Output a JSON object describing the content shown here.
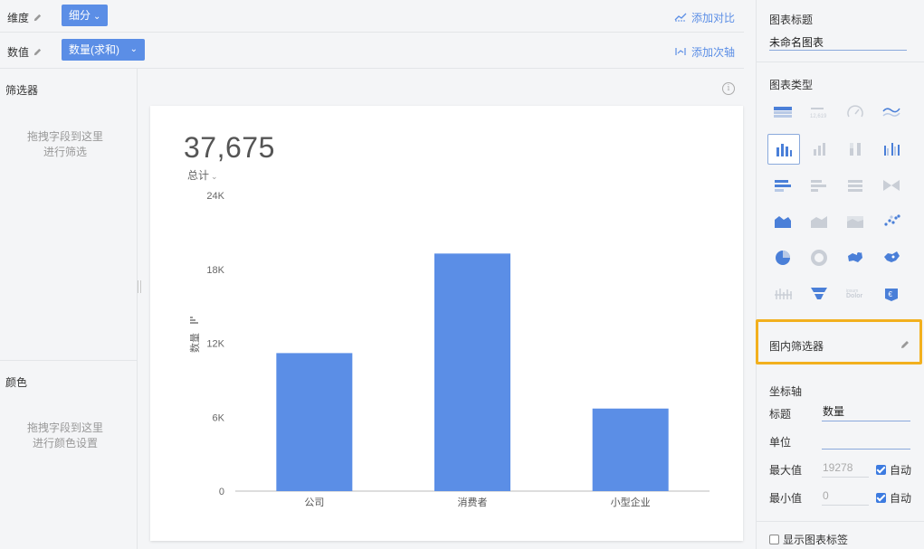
{
  "shelves": {
    "dimension": {
      "label": "维度",
      "pill": "细分",
      "action": "添加对比"
    },
    "value": {
      "label": "数值",
      "pill": "数量(求和)",
      "action": "添加次轴"
    }
  },
  "left_panel": {
    "filter_title": "筛选器",
    "filter_hint_1": "拖拽字段到这里",
    "filter_hint_2": "进行筛选",
    "color_title": "颜色",
    "color_hint_1": "拖拽字段到这里",
    "color_hint_2": "进行颜色设置"
  },
  "kpi": {
    "value": "37,675",
    "label": "总计"
  },
  "chart_data": {
    "type": "bar",
    "categories": [
      "公司",
      "消费者",
      "小型企业"
    ],
    "values": [
      11200,
      19278,
      6700
    ],
    "xlabel": "",
    "ylabel": "数量",
    "ylim": [
      0,
      24000
    ],
    "yticks": [
      0,
      6000,
      12000,
      18000,
      24000
    ],
    "ytick_labels": [
      "0",
      "6K",
      "12K",
      "18K",
      "24K"
    ],
    "bar_color": "#5b8ee6",
    "grid": false
  },
  "right_panel": {
    "chart_title_label": "图表标题",
    "chart_title_value": "未命名图表",
    "chart_type_label": "图表类型",
    "chart_types": [
      "table-icon",
      "kpi-number-icon",
      "gauge-icon",
      "line-wave-icon",
      "bar-chart-icon",
      "stacked-bar-icon",
      "percent-bar-icon",
      "grouped-bar-icon",
      "horizontal-bar-icon",
      "stacked-horizontal-bar-icon",
      "percent-horizontal-bar-icon",
      "bowtie-icon",
      "area-chart-icon",
      "stacked-area-icon",
      "percent-area-icon",
      "scatter-icon",
      "pie-chart-icon",
      "donut-chart-icon",
      "map-icon",
      "china-map-icon",
      "comb-icon",
      "funnel-icon",
      "word-cloud-icon",
      "map-pin-icon"
    ],
    "word_cloud_text": "Dolor",
    "kpi_type_text": "12,619",
    "in_chart_filter": "图内筛选器",
    "axis_section": "坐标轴",
    "axis_title_label": "标题",
    "axis_title_value": "数量",
    "axis_unit_label": "单位",
    "axis_unit_value": "",
    "axis_max_label": "最大值",
    "axis_max_value": "19278",
    "axis_min_label": "最小值",
    "axis_min_value": "0",
    "auto_label": "自动",
    "show_label": "显示图表标签"
  },
  "colors": {
    "accent": "#5b8ee6",
    "highlight": "#f2b01e"
  }
}
